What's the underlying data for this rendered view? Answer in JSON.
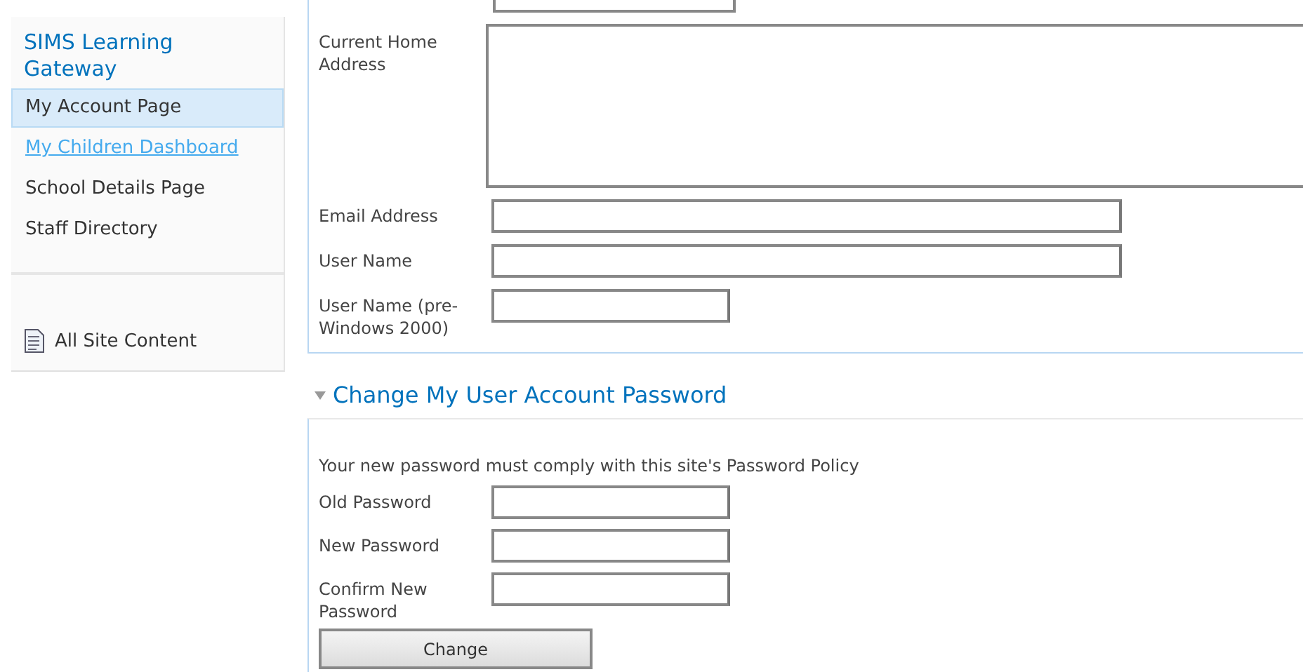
{
  "sidebar": {
    "title": "SIMS Learning Gateway",
    "items": [
      {
        "label": "My Account Page",
        "selected": true,
        "hovered": false
      },
      {
        "label": "My Children Dashboard",
        "selected": false,
        "hovered": true
      },
      {
        "label": "School Details Page",
        "selected": false,
        "hovered": false
      },
      {
        "label": "Staff Directory",
        "selected": false,
        "hovered": false
      }
    ],
    "footer_link": "All Site Content"
  },
  "details": {
    "fields": [
      {
        "label": "Current Home Address",
        "kind": "textarea"
      },
      {
        "label": "Email Address",
        "kind": "wide"
      },
      {
        "label": "User Name",
        "kind": "wide"
      },
      {
        "label": "User Name (pre-Windows 2000)",
        "kind": "short"
      }
    ]
  },
  "password_section": {
    "title": "Change My User Account Password",
    "expanded": true,
    "policy": "Your new password must comply with this site's Password Policy",
    "fields": [
      {
        "label": "Old Password",
        "kind": "short"
      },
      {
        "label": "New Password",
        "kind": "short"
      },
      {
        "label": "Confirm New Password",
        "kind": "short"
      }
    ],
    "button": "Change"
  }
}
